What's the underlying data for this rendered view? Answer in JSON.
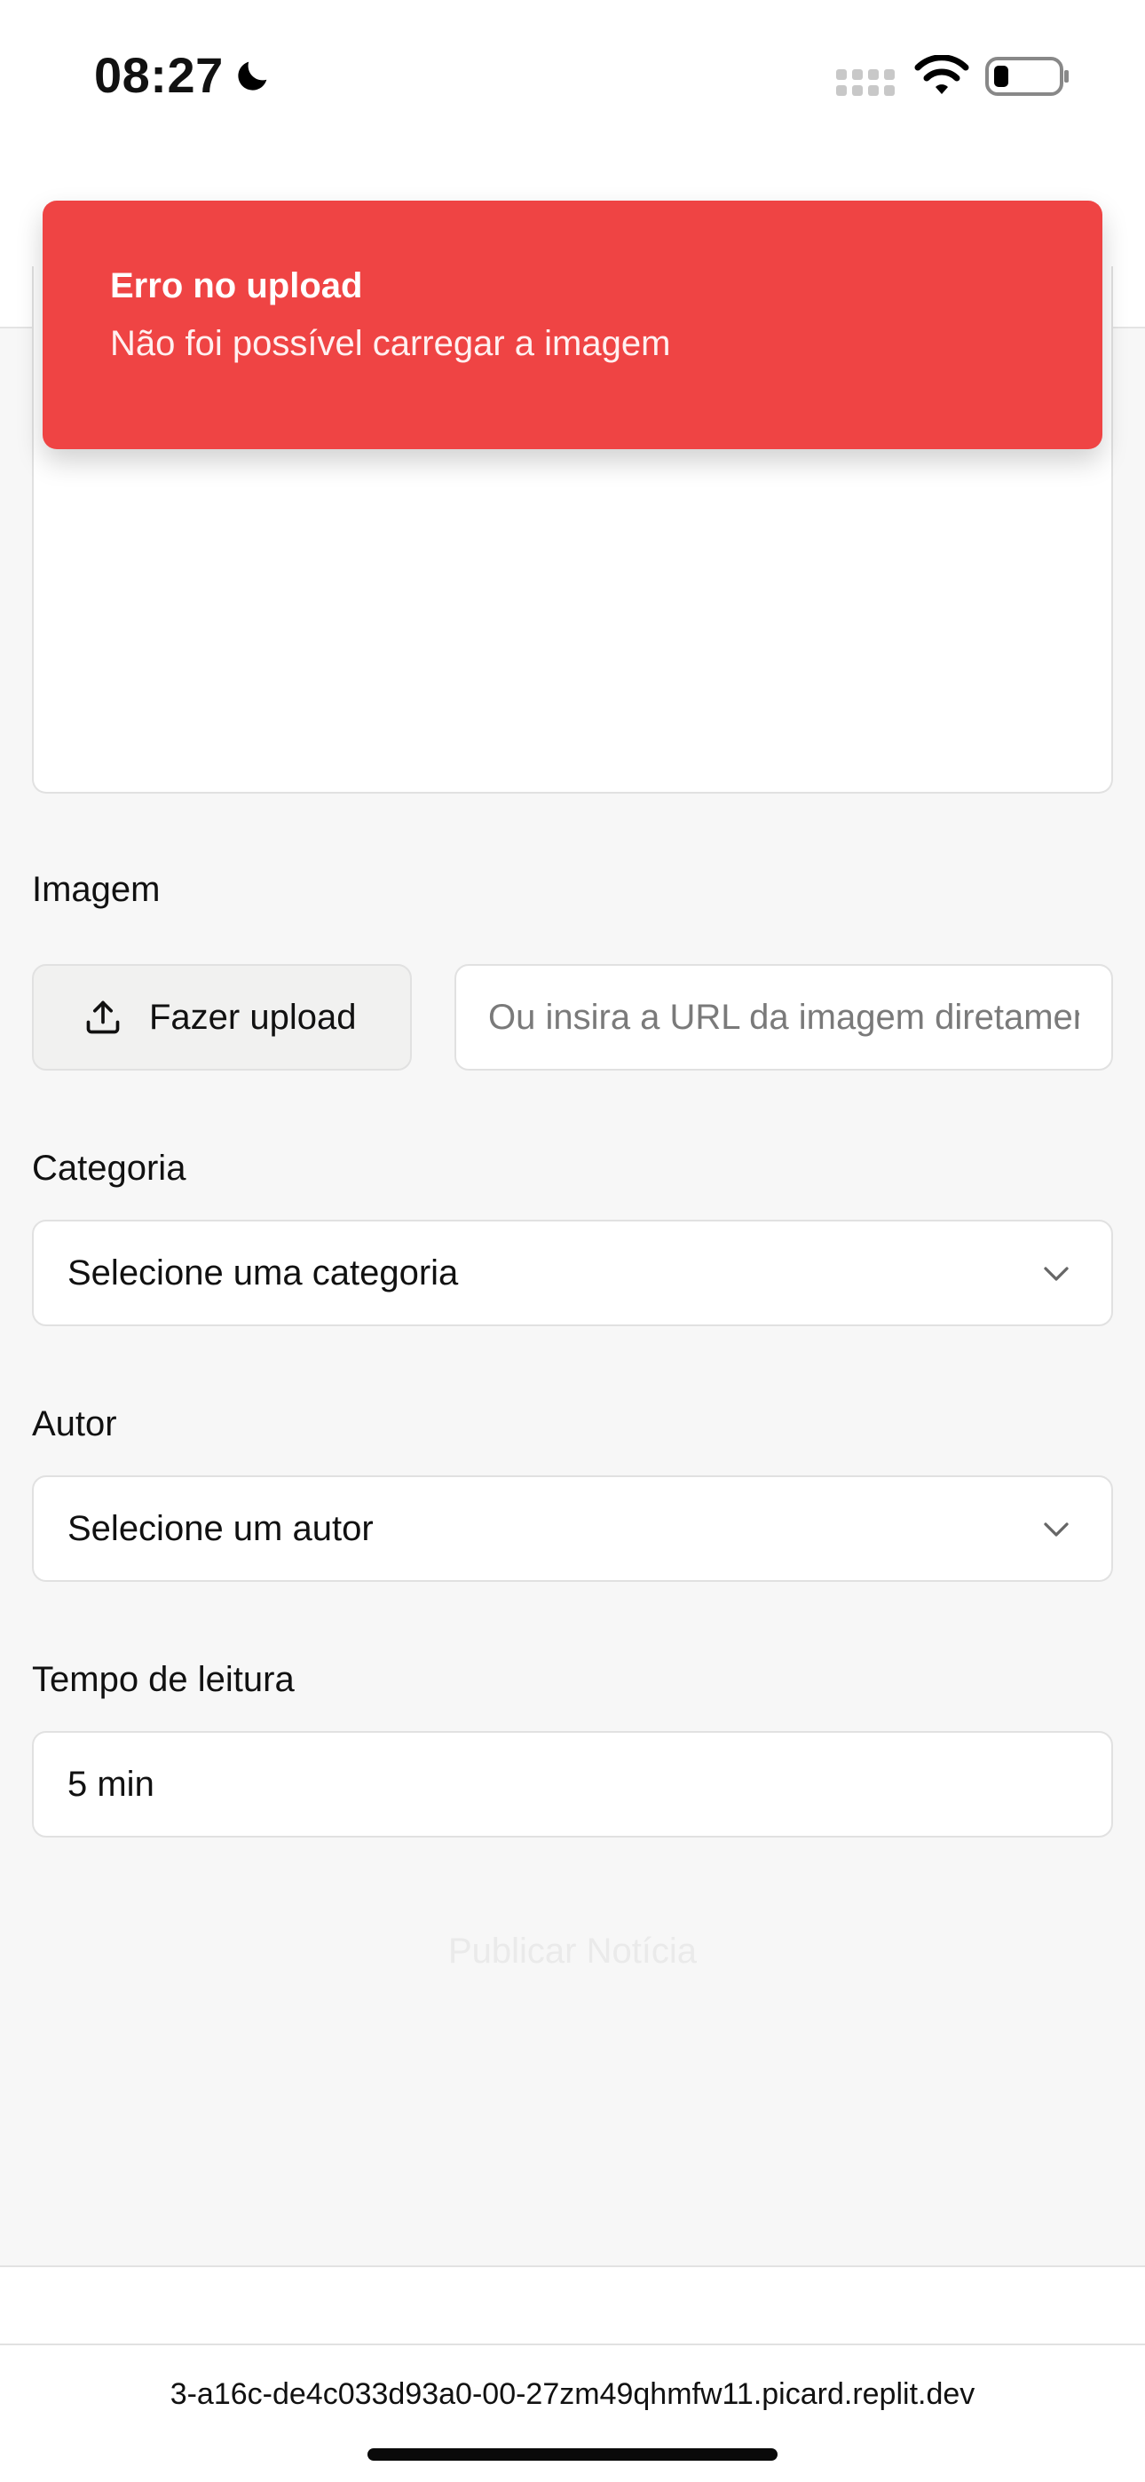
{
  "status_bar": {
    "time": "08:27",
    "icons": [
      "moon-icon",
      "signal-icon",
      "wifi-icon",
      "battery-icon"
    ]
  },
  "toast": {
    "title": "Erro no upload",
    "message": "Não foi possível carregar a imagem",
    "color": "#ef4444"
  },
  "form": {
    "image_label": "Imagem",
    "upload_button": "Fazer upload",
    "url_placeholder": "Ou insira a URL da imagem diretamente",
    "category_label": "Categoria",
    "category_value": "Selecione uma categoria",
    "author_label": "Autor",
    "author_value": "Selecione um autor",
    "reading_time_label": "Tempo de leitura",
    "reading_time_value": "5 min",
    "publish_label": "Publicar Notícia"
  },
  "browser": {
    "url": "3-a16c-de4c033d93a0-00-27zm49qhmfw11.picard.replit.dev"
  }
}
